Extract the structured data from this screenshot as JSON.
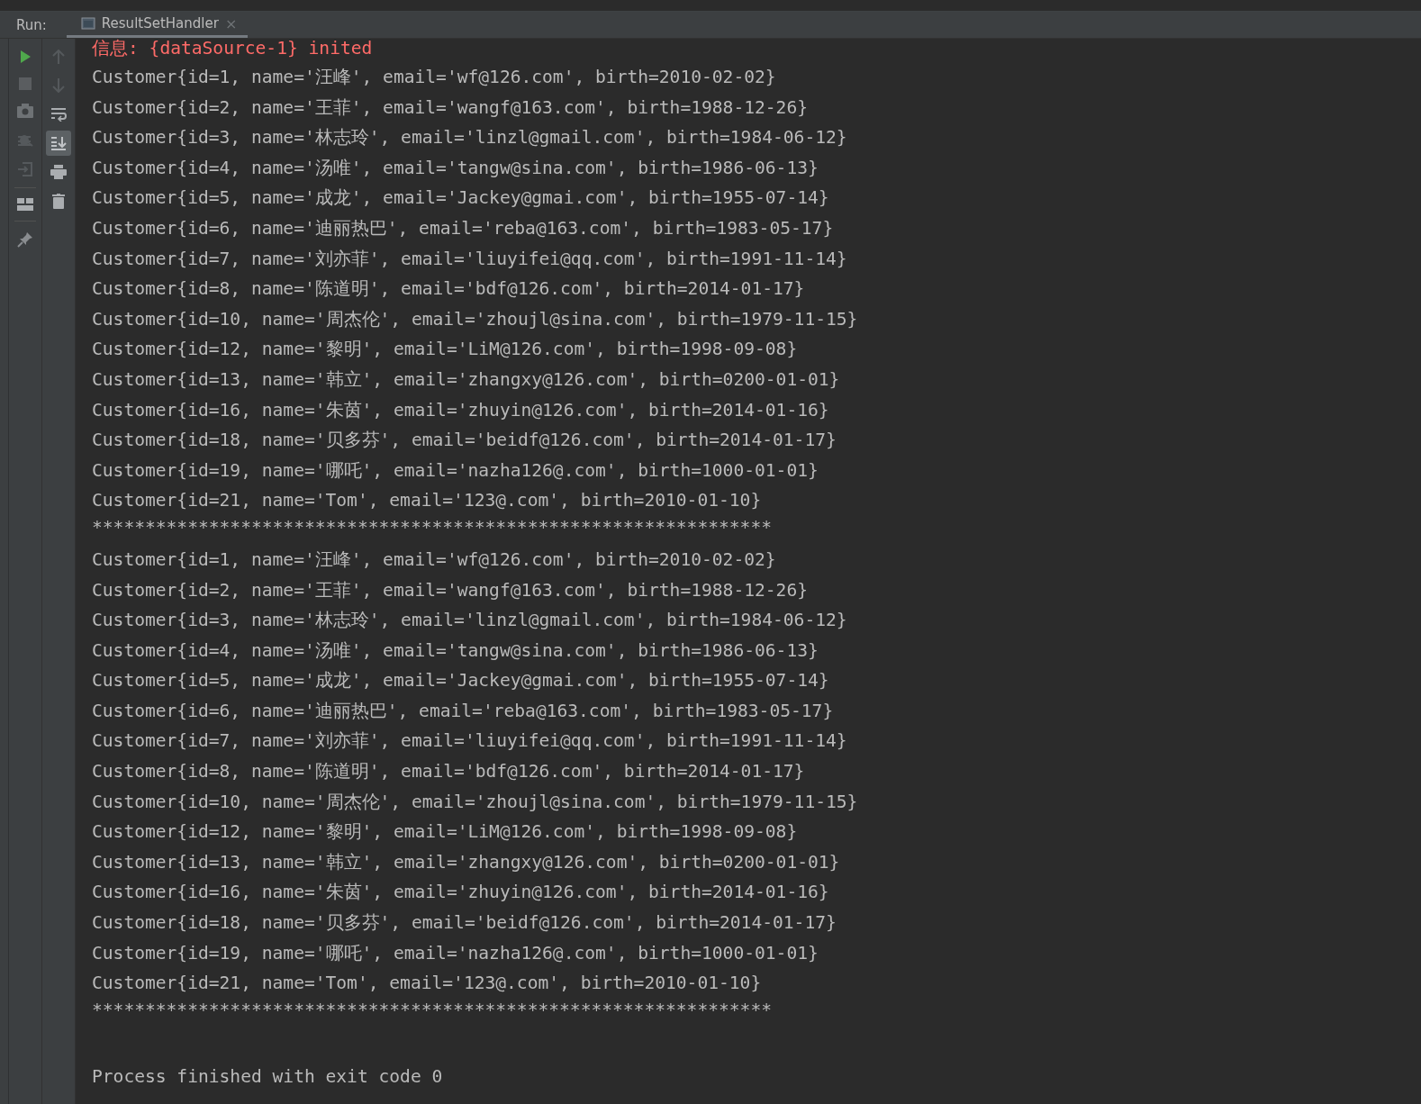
{
  "run_panel": {
    "label": "Run:",
    "tabs": [
      {
        "label": "ResultSetHandler",
        "close": "×",
        "selected": true
      }
    ]
  },
  "toolbar": {
    "scroll_to_end_on": true
  },
  "console": {
    "lines": [
      {
        "kind": "info",
        "text": "信息: {dataSource-1} inited"
      },
      {
        "kind": "out",
        "text": "Customer{id=1, name='汪峰', email='wf@126.com', birth=2010-02-02}"
      },
      {
        "kind": "out",
        "text": "Customer{id=2, name='王菲', email='wangf@163.com', birth=1988-12-26}"
      },
      {
        "kind": "out",
        "text": "Customer{id=3, name='林志玲', email='linzl@gmail.com', birth=1984-06-12}"
      },
      {
        "kind": "out",
        "text": "Customer{id=4, name='汤唯', email='tangw@sina.com', birth=1986-06-13}"
      },
      {
        "kind": "out",
        "text": "Customer{id=5, name='成龙', email='Jackey@gmai.com', birth=1955-07-14}"
      },
      {
        "kind": "out",
        "text": "Customer{id=6, name='迪丽热巴', email='reba@163.com', birth=1983-05-17}"
      },
      {
        "kind": "out",
        "text": "Customer{id=7, name='刘亦菲', email='liuyifei@qq.com', birth=1991-11-14}"
      },
      {
        "kind": "out",
        "text": "Customer{id=8, name='陈道明', email='bdf@126.com', birth=2014-01-17}"
      },
      {
        "kind": "out",
        "text": "Customer{id=10, name='周杰伦', email='zhoujl@sina.com', birth=1979-11-15}"
      },
      {
        "kind": "out",
        "text": "Customer{id=12, name='黎明', email='LiM@126.com', birth=1998-09-08}"
      },
      {
        "kind": "out",
        "text": "Customer{id=13, name='韩立', email='zhangxy@126.com', birth=0200-01-01}"
      },
      {
        "kind": "out",
        "text": "Customer{id=16, name='朱茵', email='zhuyin@126.com', birth=2014-01-16}"
      },
      {
        "kind": "out",
        "text": "Customer{id=18, name='贝多芬', email='beidf@126.com', birth=2014-01-17}"
      },
      {
        "kind": "out",
        "text": "Customer{id=19, name='哪吒', email='nazha126@.com', birth=1000-01-01}"
      },
      {
        "kind": "out",
        "text": "Customer{id=21, name='Tom', email='123@.com', birth=2010-01-10}"
      },
      {
        "kind": "sep",
        "text": "****************************************************************"
      },
      {
        "kind": "out",
        "text": "Customer{id=1, name='汪峰', email='wf@126.com', birth=2010-02-02}"
      },
      {
        "kind": "out",
        "text": "Customer{id=2, name='王菲', email='wangf@163.com', birth=1988-12-26}"
      },
      {
        "kind": "out",
        "text": "Customer{id=3, name='林志玲', email='linzl@gmail.com', birth=1984-06-12}"
      },
      {
        "kind": "out",
        "text": "Customer{id=4, name='汤唯', email='tangw@sina.com', birth=1986-06-13}"
      },
      {
        "kind": "out",
        "text": "Customer{id=5, name='成龙', email='Jackey@gmai.com', birth=1955-07-14}"
      },
      {
        "kind": "out",
        "text": "Customer{id=6, name='迪丽热巴', email='reba@163.com', birth=1983-05-17}"
      },
      {
        "kind": "out",
        "text": "Customer{id=7, name='刘亦菲', email='liuyifei@qq.com', birth=1991-11-14}"
      },
      {
        "kind": "out",
        "text": "Customer{id=8, name='陈道明', email='bdf@126.com', birth=2014-01-17}"
      },
      {
        "kind": "out",
        "text": "Customer{id=10, name='周杰伦', email='zhoujl@sina.com', birth=1979-11-15}"
      },
      {
        "kind": "out",
        "text": "Customer{id=12, name='黎明', email='LiM@126.com', birth=1998-09-08}"
      },
      {
        "kind": "out",
        "text": "Customer{id=13, name='韩立', email='zhangxy@126.com', birth=0200-01-01}"
      },
      {
        "kind": "out",
        "text": "Customer{id=16, name='朱茵', email='zhuyin@126.com', birth=2014-01-16}"
      },
      {
        "kind": "out",
        "text": "Customer{id=18, name='贝多芬', email='beidf@126.com', birth=2014-01-17}"
      },
      {
        "kind": "out",
        "text": "Customer{id=19, name='哪吒', email='nazha126@.com', birth=1000-01-01}"
      },
      {
        "kind": "out",
        "text": "Customer{id=21, name='Tom', email='123@.com', birth=2010-01-10}"
      },
      {
        "kind": "sep",
        "text": "****************************************************************"
      },
      {
        "kind": "blank"
      },
      {
        "kind": "out",
        "text": "Process finished with exit code 0"
      }
    ]
  }
}
